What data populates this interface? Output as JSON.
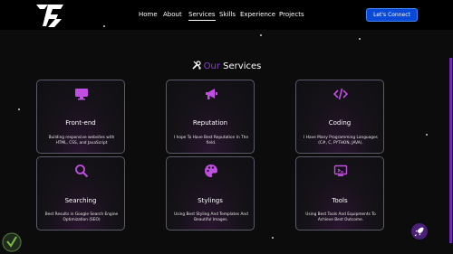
{
  "header": {
    "nav": [
      {
        "label": "Home",
        "active": false
      },
      {
        "label": "About",
        "active": false
      },
      {
        "label": "Services",
        "active": true
      },
      {
        "label": "Skills",
        "active": false
      },
      {
        "label": "Experience",
        "active": false
      },
      {
        "label": "Projects",
        "active": false
      }
    ],
    "cta_label": "Let's Connect"
  },
  "section": {
    "title_accent": "Our",
    "title_rest": "Services"
  },
  "services": [
    {
      "title": "Front-end",
      "description": "Building responsive websites with HTML, CSS, and JavaScript",
      "icon": "monitor-icon"
    },
    {
      "title": "Reputation",
      "description": "I hope To Have Best Reputation In The field.",
      "icon": "megaphone-icon"
    },
    {
      "title": "Coding",
      "description": "I Have Many Programming Languages (C#, C, PYTHON, JAVA).",
      "icon": "code-icon"
    },
    {
      "title": "Searching",
      "description": "Best Results in Google Search Engine Optimization (SEO)",
      "icon": "search-icon"
    },
    {
      "title": "Stylings",
      "description": "Using Best Styling And Templates And Beautiful Images.",
      "icon": "palette-icon"
    },
    {
      "title": "Tools",
      "description": "Using Best Tools And Equipments To Achieve Best Outcome.",
      "icon": "tools-monitor-icon"
    }
  ],
  "colors": {
    "accent": "#8a40d6",
    "icon": "#c04ee0",
    "button": "#0a49d6",
    "background": "#0c0c0c"
  }
}
